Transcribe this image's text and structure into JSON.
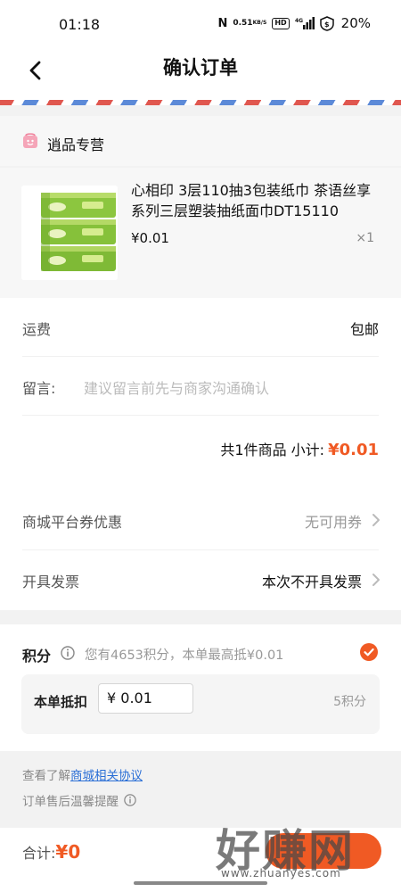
{
  "status_bar": {
    "time": "01:18",
    "nfc": "N",
    "net_speed_value": "0.51",
    "net_speed_unit": "KB/S",
    "hd_label": "HD",
    "network_label": "4G",
    "battery_percent": "20%"
  },
  "nav": {
    "title": "确认订单"
  },
  "store": {
    "name": "逍品专营",
    "brand_color": "#f05a24"
  },
  "product": {
    "name": "心相印 3层110抽3包装纸巾 茶语丝享系列三层塑装抽纸面巾DT15110",
    "price": "¥0.01",
    "quantity": "×1",
    "image_icon": "tissue-pack-image"
  },
  "order_details": {
    "shipping_label": "运费",
    "shipping_value": "包邮",
    "message_label": "留言:",
    "message_placeholder": "建议留言前先与商家沟通确认",
    "subtotal_text": "共1件商品 小计:",
    "subtotal_amount": "¥0.01"
  },
  "options": {
    "coupon_label": "商城平台券优惠",
    "coupon_value": "无可用券",
    "invoice_label": "开具发票",
    "invoice_value": "本次不开具发票"
  },
  "points": {
    "title": "积分",
    "description": "您有4653积分，本单最高抵¥0.01",
    "checked": true,
    "deduct_label": "本单抵扣",
    "deduct_input_value": "¥ 0.01",
    "points_used": "5积分"
  },
  "footer": {
    "agreement_prefix": "查看了解",
    "agreement_link": "商城相关协议",
    "after_sale_notice": "订单售后温馨提醒"
  },
  "bottom_bar": {
    "total_label": "合计:",
    "total_amount": "¥0"
  },
  "watermark": {
    "text": "好赚网",
    "url": "www.zhuanyes.com"
  }
}
